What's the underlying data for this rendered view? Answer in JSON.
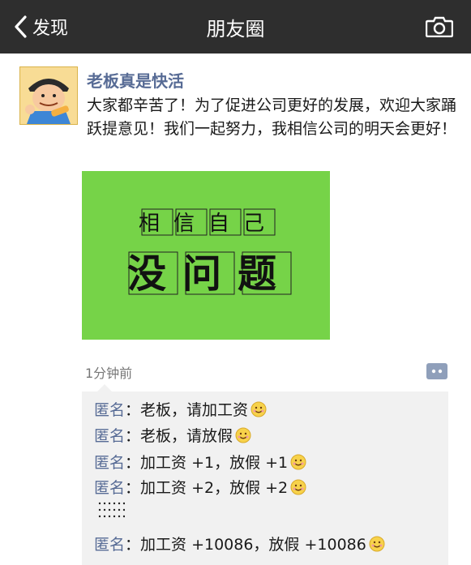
{
  "header": {
    "back_label": "发现",
    "title": "朋友圈",
    "icons": {
      "back": "chevron-left-icon",
      "camera": "camera-icon"
    },
    "bg_color": "#2e2e2e"
  },
  "post": {
    "author": "老板真是快活",
    "text": "大家都辛苦了！为了促进公司更好的发展，欢迎大家踊跃提意见！我们一起努力，我相信公司的明天会更好！",
    "image_text": {
      "line1": "相信自己",
      "line2": "没问题"
    },
    "image_color": "#76d348",
    "time": "1分钟前",
    "name_color": "#576b95"
  },
  "comments": [
    {
      "name": "匿名",
      "sep": "：",
      "text": "老板，请加工资",
      "emoji": "smile-icon"
    },
    {
      "name": "匿名",
      "sep": "：",
      "text": "老板，请放假",
      "emoji": "smile-icon"
    },
    {
      "name": "匿名",
      "sep": "：",
      "text": "加工资 +1，放假 +1",
      "emoji": "smile-icon"
    },
    {
      "name": "匿名",
      "sep": "：",
      "text": "加工资 +2，放假 +2",
      "emoji": "smile-icon"
    },
    {
      "name": "匿名",
      "sep": "：",
      "text": "加工资 +10086，放假 +10086",
      "emoji": "smile-icon"
    }
  ]
}
